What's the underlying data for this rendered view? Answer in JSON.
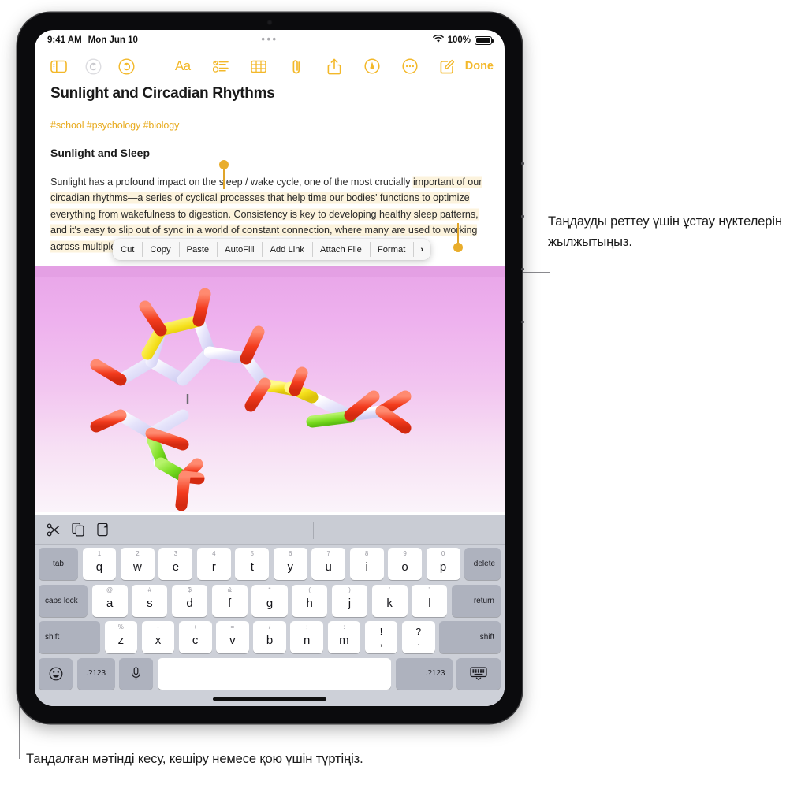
{
  "statusbar": {
    "time": "9:41 AM",
    "date": "Mon Jun 10",
    "center_dots": "•••",
    "wifi_icon": "wifi-icon",
    "battery_percent": "100%",
    "battery_icon": "battery-full-icon"
  },
  "toolbar": {
    "sidebar_icon": "sidebar-toggle-icon",
    "undo_icon": "undo-icon",
    "redo_icon": "redo-icon",
    "format_label": "Aa",
    "checklist_icon": "checklist-icon",
    "table_icon": "table-icon",
    "attach_icon": "paperclip-icon",
    "share_icon": "share-icon",
    "markup_icon": "markup-pen-icon",
    "more_icon": "more-ellipsis-icon",
    "compose_icon": "compose-icon",
    "done_label": "Done",
    "accent_color": "#f3b829"
  },
  "note": {
    "title": "Sunlight and Circadian Rhythms",
    "tags": "#school #psychology #biology",
    "tags_color": "#e8ab1f",
    "heading": "Sunlight and Sleep",
    "paragraph_unselected": "Sunlight has a profound impact on the sleep / wake cycle, one of the most crucially ",
    "paragraph_selected": "important of our circadian rhythms—a series of cyclical processes that help time our bodies' functions to optimize everything from wakefulness to digestion. Consistency is key to developing healthy sleep patterns, and it's easy to slip out of sync in a world of constant connection, where many are used to working across multiple timezones.",
    "selection_highlight_color": "#fcf3dd",
    "selection_handle_color": "#e9ad2b",
    "image_alt": "molecule-3d-render"
  },
  "context_menu": {
    "items": [
      {
        "label": "Cut"
      },
      {
        "label": "Copy"
      },
      {
        "label": "Paste"
      },
      {
        "label": "AutoFill"
      },
      {
        "label": "Add Link"
      },
      {
        "label": "Attach File"
      },
      {
        "label": "Format"
      }
    ],
    "more_label": "›"
  },
  "keyboard": {
    "shortcut_bar": {
      "cut_icon": "scissors-icon",
      "copy_icon": "copy-pages-icon",
      "paste_icon": "paste-clipboard-icon"
    },
    "row1": {
      "tab": "tab",
      "keys": [
        {
          "sub": "1",
          "main": "q"
        },
        {
          "sub": "2",
          "main": "w"
        },
        {
          "sub": "3",
          "main": "e"
        },
        {
          "sub": "4",
          "main": "r"
        },
        {
          "sub": "5",
          "main": "t"
        },
        {
          "sub": "6",
          "main": "y"
        },
        {
          "sub": "7",
          "main": "u"
        },
        {
          "sub": "8",
          "main": "i"
        },
        {
          "sub": "9",
          "main": "o"
        },
        {
          "sub": "0",
          "main": "p"
        }
      ],
      "delete": "delete"
    },
    "row2": {
      "caps_lock": "caps lock",
      "keys": [
        {
          "sub": "@",
          "main": "a"
        },
        {
          "sub": "#",
          "main": "s"
        },
        {
          "sub": "$",
          "main": "d"
        },
        {
          "sub": "&",
          "main": "f"
        },
        {
          "sub": "*",
          "main": "g"
        },
        {
          "sub": "(",
          "main": "h"
        },
        {
          "sub": ")",
          "main": "j"
        },
        {
          "sub": "'",
          "main": "k"
        },
        {
          "sub": "\"",
          "main": "l"
        }
      ],
      "return": "return"
    },
    "row3": {
      "shift_left": "shift",
      "keys": [
        {
          "sub": "%",
          "main": "z"
        },
        {
          "sub": "-",
          "main": "x"
        },
        {
          "sub": "+",
          "main": "c"
        },
        {
          "sub": "=",
          "main": "v"
        },
        {
          "sub": "/",
          "main": "b"
        },
        {
          "sub": ";",
          "main": "n"
        },
        {
          "sub": ":",
          "main": "m"
        }
      ],
      "dual_keys": [
        {
          "up": "!",
          "lo": ","
        },
        {
          "up": "?",
          "lo": "."
        }
      ],
      "shift_right": "shift"
    },
    "row4": {
      "emoji_icon": "emoji-smiley-icon",
      "numbers_left": ".?123",
      "mic_icon": "microphone-icon",
      "space": "",
      "numbers_right": ".?123",
      "dismiss_icon": "hide-keyboard-icon"
    }
  },
  "callouts": {
    "right": "Таңдауды реттеу үшін ұстау нүктелерін жылжытыңыз.",
    "bottom": "Таңдалған мәтінді кесу, көшіру немесе қою үшін түртіңіз."
  }
}
